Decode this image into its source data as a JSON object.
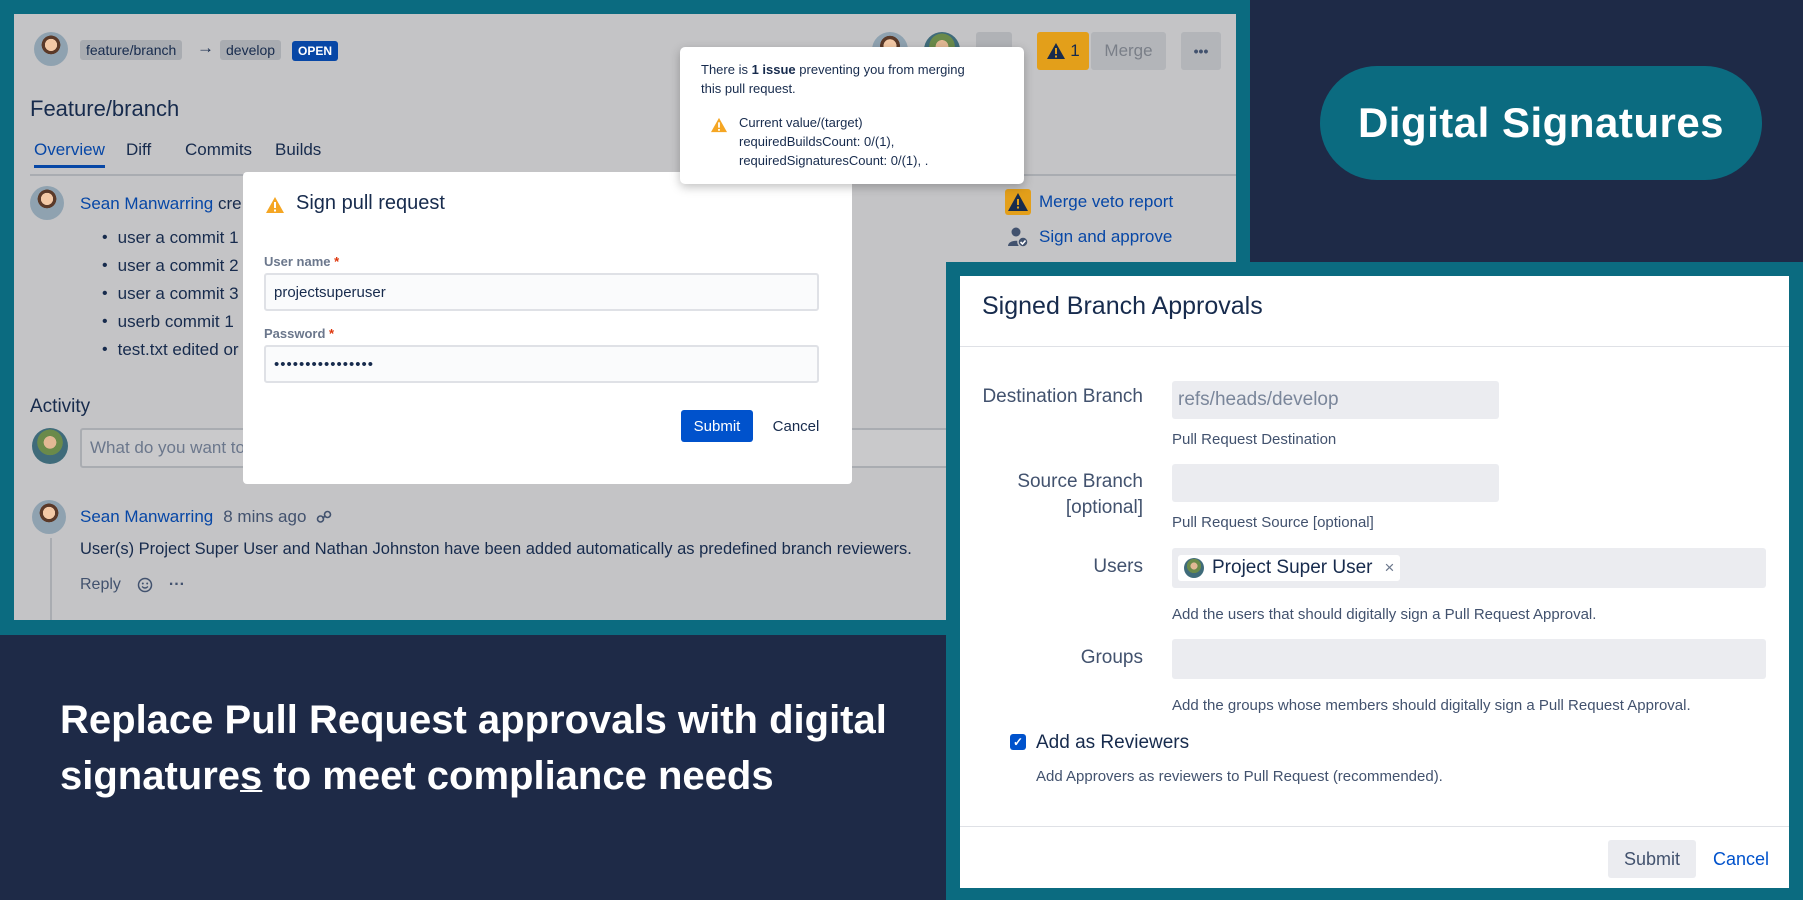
{
  "pr": {
    "source_branch": "feature/branch",
    "arrow": "→",
    "target_branch": "develop",
    "status": "OPEN",
    "title": "Feature/branch",
    "issue_count": "1",
    "merge_label": "Merge",
    "more_label": "•••",
    "tabs": [
      "Overview",
      "Diff",
      "Commits",
      "Builds"
    ],
    "author": "Sean Manwarring",
    "author_action": "cre",
    "commits": [
      "user a commit 1",
      "user a commit 2",
      "user a commit 3",
      "userb commit 1",
      "test.txt edited or"
    ],
    "veto_link": "Merge veto report",
    "sign_link": "Sign and approve",
    "activity_heading": "Activity",
    "comment_placeholder": "What do you want to",
    "activity_author": "Sean Manwarring",
    "activity_time": "8 mins ago",
    "activity_text": "User(s) Project Super User and Nathan Johnston have been added automatically as predefined branch reviewers.",
    "reply_label": "Reply",
    "reply_more": "···"
  },
  "tooltip": {
    "line1_pre": "There is ",
    "line1_bold": "1 issue",
    "line1_post": " preventing you from merging",
    "line2": "this pull request.",
    "issue_lines": [
      "Current value/(target)",
      "requiredBuildsCount: 0/(1),",
      "requiredSignaturesCount: 0/(1), ."
    ]
  },
  "sign_dialog": {
    "title": "Sign pull request",
    "username_label": "User name",
    "username_value": "projectsuperuser",
    "password_label": "Password",
    "password_value": "••••••••••••••••",
    "required_mark": "*",
    "submit": "Submit",
    "cancel": "Cancel"
  },
  "badge": "Digital Signatures",
  "headline": {
    "line1": "Replace Pull Request approvals with digital",
    "line2_a": "signature",
    "line2_u": "s",
    "line2_b": " to meet compliance needs"
  },
  "sba": {
    "title": "Signed Branch Approvals",
    "dest_label": "Destination Branch",
    "dest_value": "refs/heads/develop",
    "dest_help": "Pull Request Destination",
    "source_label_1": "Source Branch",
    "source_label_2": "[optional]",
    "source_help": "Pull Request Source [optional]",
    "users_label": "Users",
    "user_chip": "Project Super User",
    "chip_remove": "×",
    "users_help": "Add the users that should digitally sign a Pull Request Approval.",
    "groups_label": "Groups",
    "groups_help": "Add the groups whose members should digitally sign a Pull Request Approval.",
    "reviewers_label": "Add as Reviewers",
    "reviewers_help": "Add Approvers as reviewers to Pull Request (recommended).",
    "submit": "Submit",
    "cancel": "Cancel"
  },
  "colors": {
    "frame": "#0b6b80",
    "background": "#1e2a47",
    "primary": "#0052cc",
    "warning": "#f5a623"
  }
}
